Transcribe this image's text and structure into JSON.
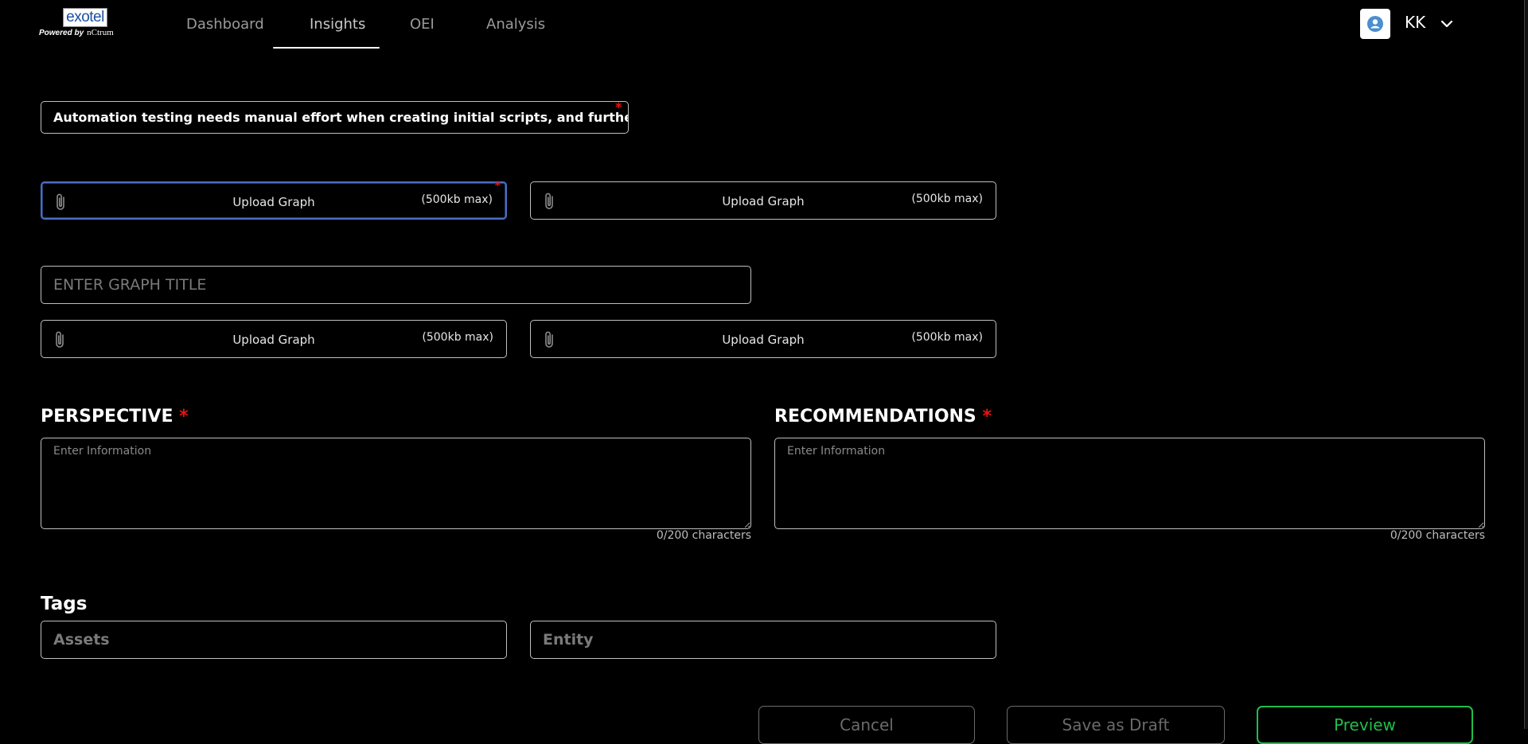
{
  "header": {
    "logo_text": "exotel",
    "powered_by": "Powered by",
    "powered_brand": "nCtrum",
    "nav": [
      "Dashboard",
      "Insights",
      "OEI",
      "Analysis"
    ],
    "active_nav": "Insights",
    "user_initials": "KK"
  },
  "form": {
    "title_value": "Automation testing needs manual effort when creating initial scripts, and further proce",
    "required_mark": "*",
    "upload": {
      "label": "Upload Graph",
      "limit": "(500kb max)"
    },
    "graph_title_placeholder": "ENTER GRAPH TITLE",
    "perspective": {
      "heading": "PERSPECTIVE",
      "placeholder": "Enter Information",
      "counter": "0/200 characters"
    },
    "recommendations": {
      "heading": "RECOMMENDATIONS",
      "placeholder": "Enter Information",
      "counter": "0/200 characters"
    },
    "tags": {
      "heading": "Tags",
      "assets_placeholder": "Assets",
      "entity_placeholder": "Entity"
    }
  },
  "actions": {
    "cancel": "Cancel",
    "save_draft": "Save as Draft",
    "preview": "Preview"
  },
  "colors": {
    "background": "#000000",
    "required": "#ee1111",
    "preview_accent": "#1fbf4a",
    "focus_border": "#4a6fc0"
  }
}
